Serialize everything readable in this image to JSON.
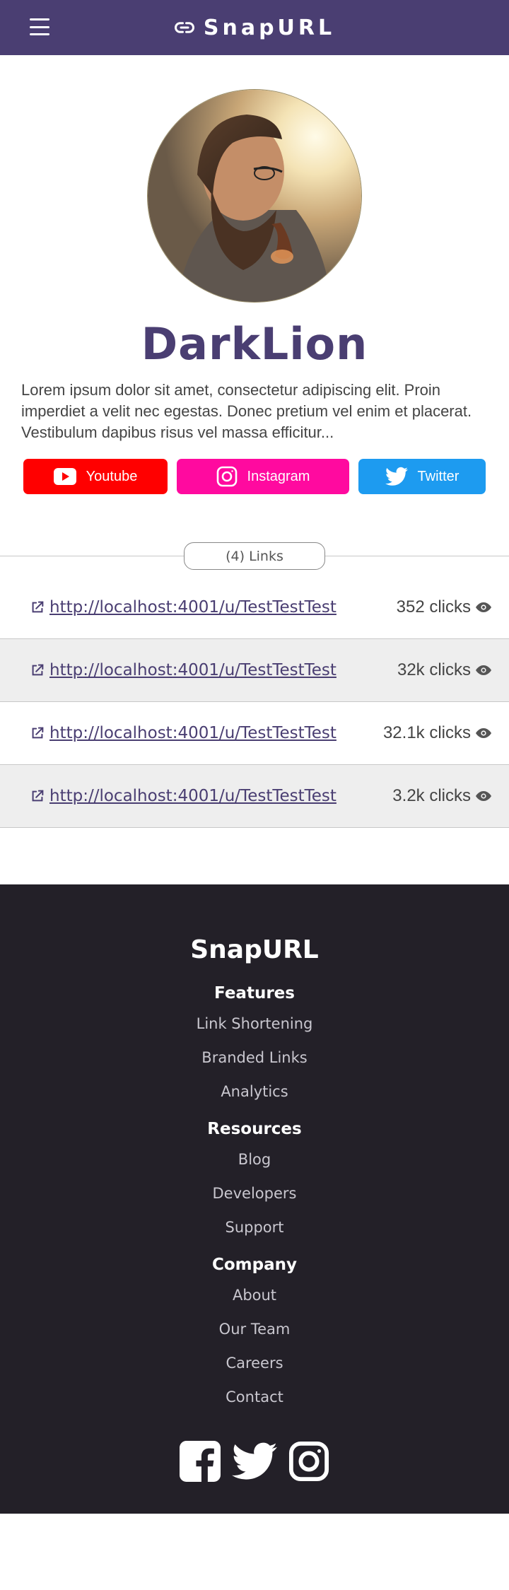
{
  "header": {
    "brand": "SnapURL",
    "menu_icon": "hamburger-menu-icon",
    "brand_icon": "link-chain-icon"
  },
  "profile": {
    "username": "DarkLion",
    "bio": "Lorem ipsum dolor sit amet, consectetur adipiscing elit. Proin imperdiet a velit nec egestas. Donec pretium vel enim et placerat. Vestibulum dapibus risus vel massa efficitur..."
  },
  "socials": {
    "youtube": {
      "label": "Youtube",
      "color": "#ff0000"
    },
    "instagram": {
      "label": "Instagram",
      "color": "#ff0a9f"
    },
    "twitter": {
      "label": "Twitter",
      "color": "#1d9bf0"
    }
  },
  "links": {
    "count_label": "(4) Links",
    "items": [
      {
        "url": "http://localhost:4001/u/TestTestTest",
        "clicks": "352 clicks"
      },
      {
        "url": "http://localhost:4001/u/TestTestTest",
        "clicks": "32k clicks"
      },
      {
        "url": "http://localhost:4001/u/TestTestTest",
        "clicks": "32.1k clicks"
      },
      {
        "url": "http://localhost:4001/u/TestTestTest",
        "clicks": "3.2k clicks"
      }
    ]
  },
  "footer": {
    "brand": "SnapURL",
    "groups": [
      {
        "heading": "Features",
        "links": [
          "Link Shortening",
          "Branded Links",
          "Analytics"
        ]
      },
      {
        "heading": "Resources",
        "links": [
          "Blog",
          "Developers",
          "Support"
        ]
      },
      {
        "heading": "Company",
        "links": [
          "About",
          "Our Team",
          "Careers",
          "Contact"
        ]
      }
    ]
  },
  "colors": {
    "primary": "#4a3e72",
    "footer_bg": "#232028",
    "row_alt": "#eeeeee"
  }
}
